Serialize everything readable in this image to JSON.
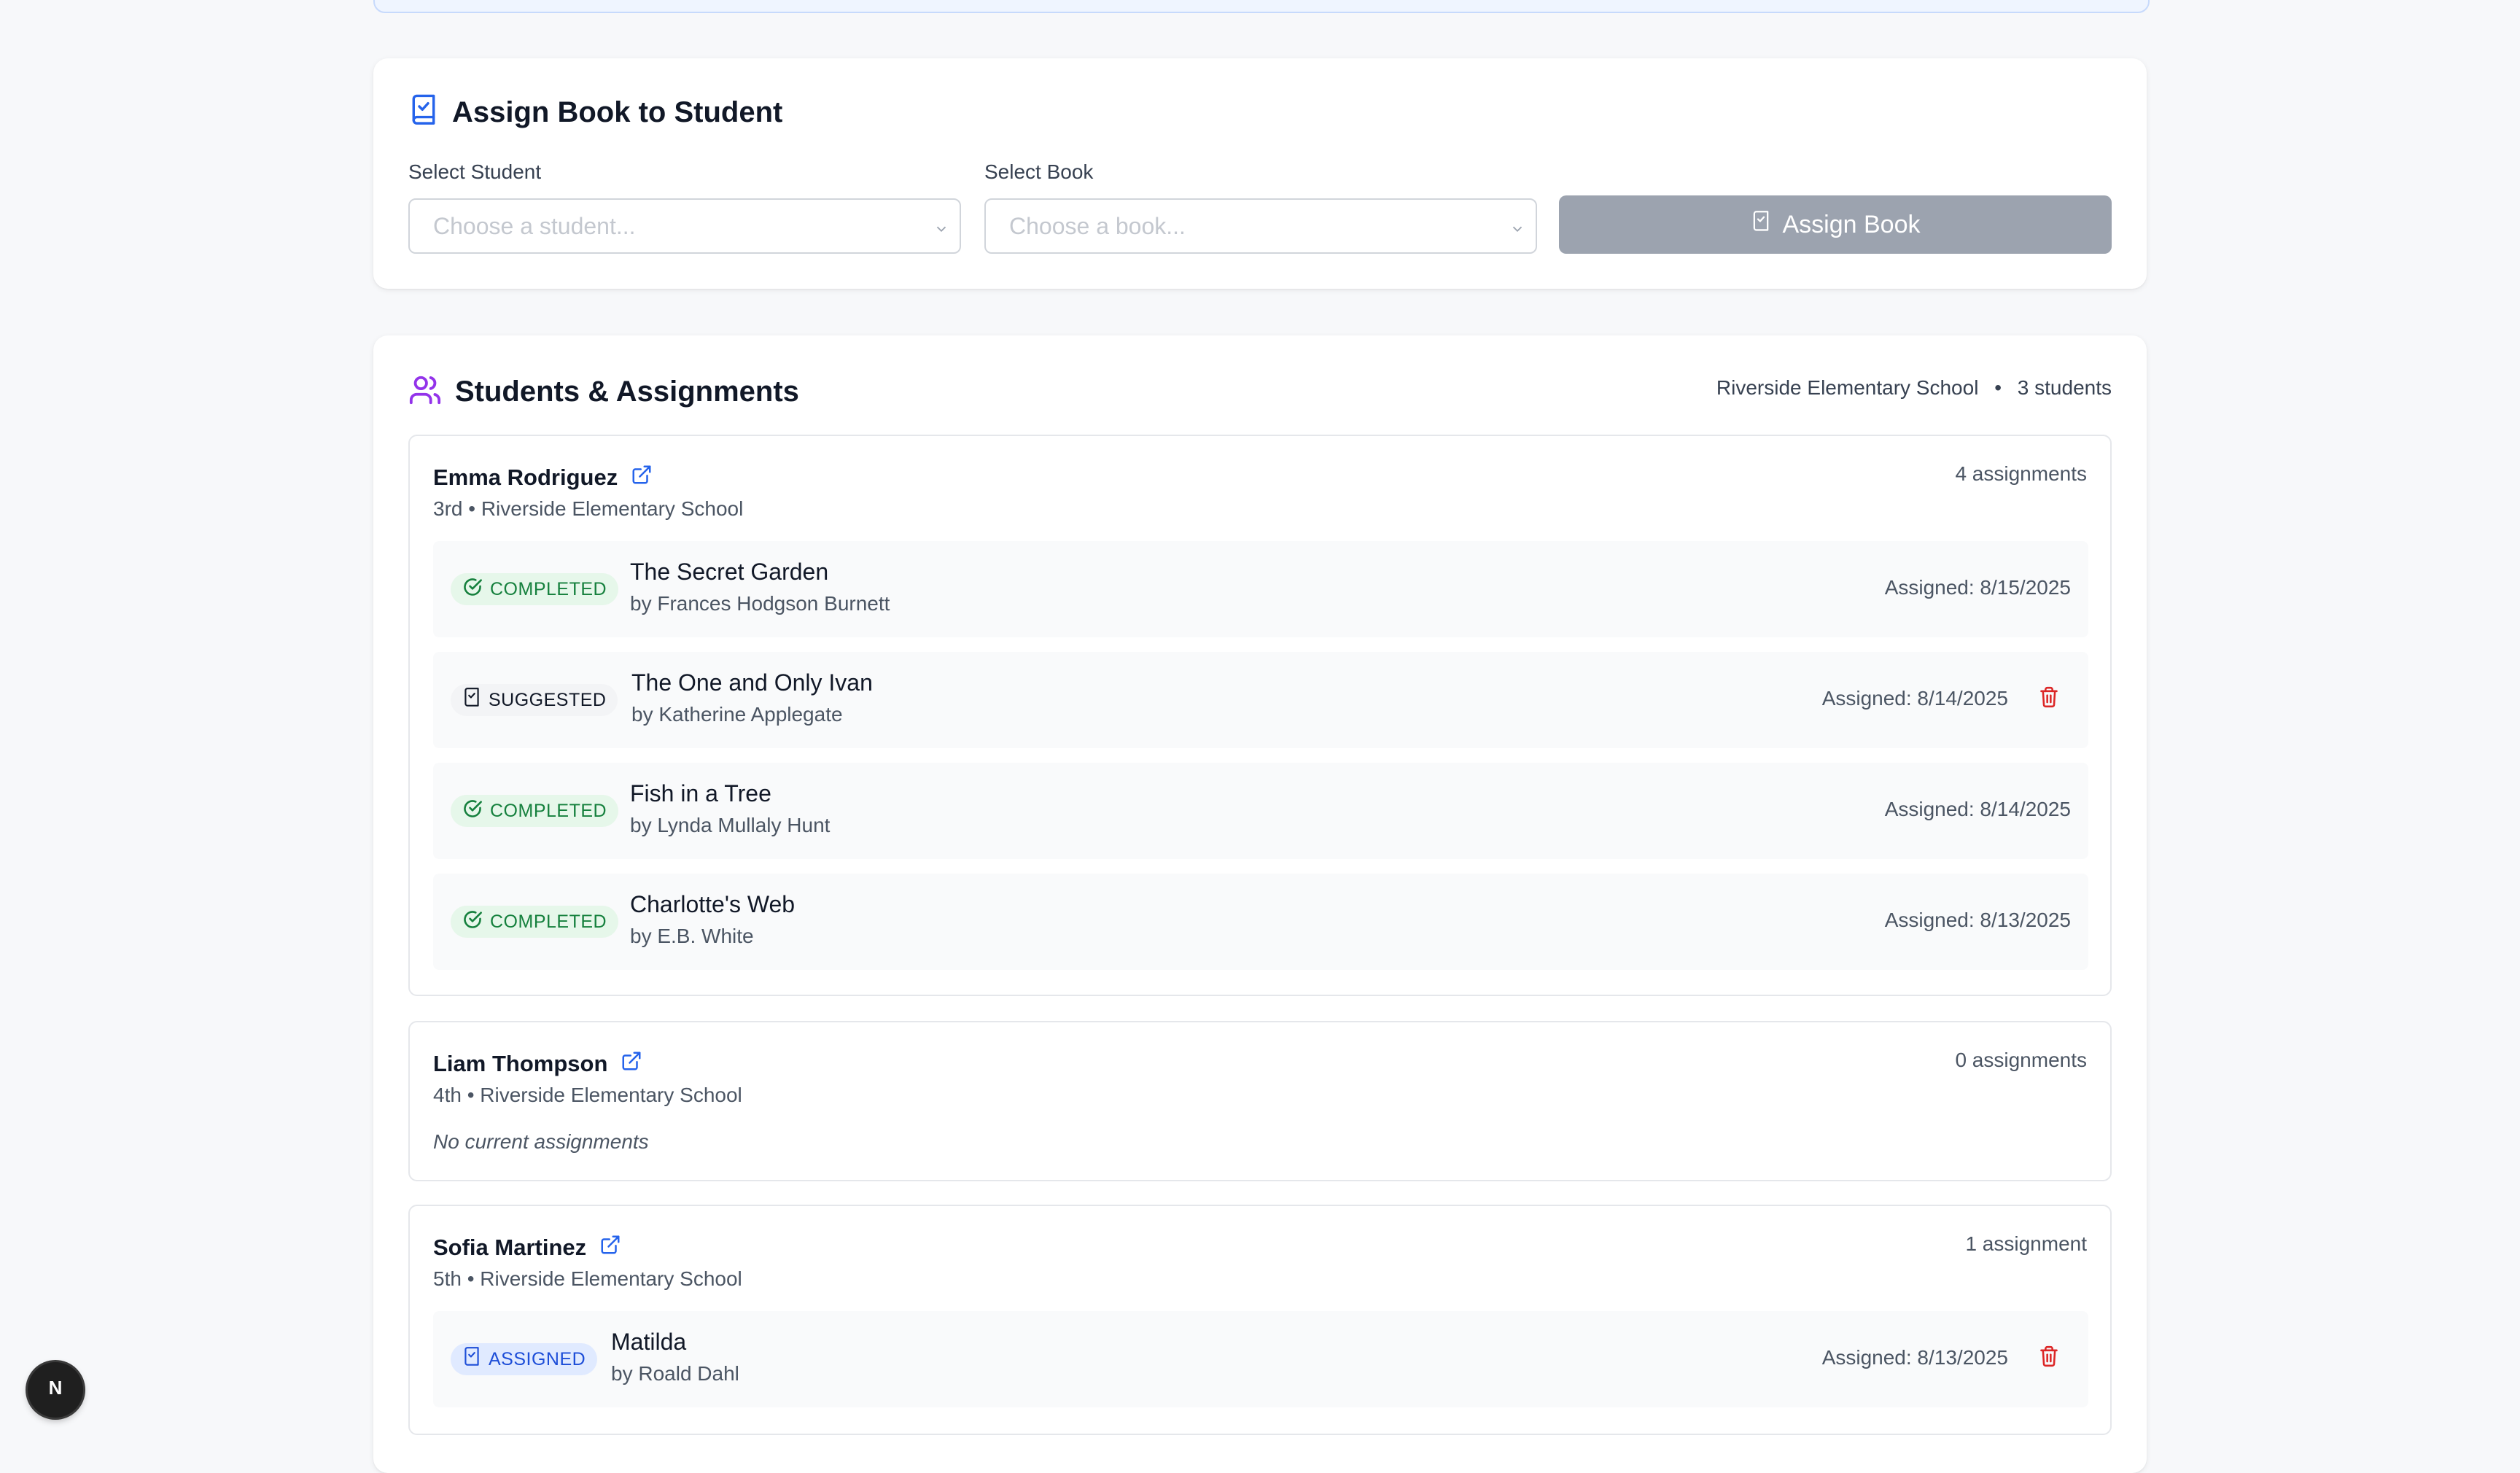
{
  "assign_section": {
    "title": "Assign Book to Student",
    "student_label": "Select Student",
    "student_placeholder": "Choose a student...",
    "book_label": "Select Book",
    "book_placeholder": "Choose a book...",
    "button_label": "Assign Book"
  },
  "students_section": {
    "title": "Students & Assignments",
    "school": "Riverside Elementary School",
    "separator": "•",
    "student_count": "3 students"
  },
  "students": [
    {
      "name": "Emma Rodriguez",
      "meta": "3rd • Riverside Elementary School",
      "count_label": "4 assignments",
      "assignments": [
        {
          "status": "COMPLETED",
          "title": "The Secret Garden",
          "author": "by Frances Hodgson Burnett",
          "date": "Assigned: 8/15/2025"
        },
        {
          "status": "SUGGESTED",
          "title": "The One and Only Ivan",
          "author": "by Katherine Applegate",
          "date": "Assigned: 8/14/2025"
        },
        {
          "status": "COMPLETED",
          "title": "Fish in a Tree",
          "author": "by Lynda Mullaly Hunt",
          "date": "Assigned: 8/14/2025"
        },
        {
          "status": "COMPLETED",
          "title": "Charlotte's Web",
          "author": "by E.B. White",
          "date": "Assigned: 8/13/2025"
        }
      ]
    },
    {
      "name": "Liam Thompson",
      "meta": "4th • Riverside Elementary School",
      "count_label": "0 assignments",
      "empty_label": "No current assignments"
    },
    {
      "name": "Sofia Martinez",
      "meta": "5th • Riverside Elementary School",
      "count_label": "1 assignment",
      "assignments": [
        {
          "status": "ASSIGNED",
          "title": "Matilda",
          "author": "by Roald Dahl",
          "date": "Assigned: 8/13/2025"
        }
      ]
    }
  ],
  "dev_badge": {
    "letter": "N"
  },
  "colors": {
    "completed": "#15803d",
    "assigned": "#1d4ed8",
    "delete": "#dc2626",
    "link": "#2563eb",
    "students_icon": "#9333ea",
    "button_disabled": "#9ca3af"
  }
}
